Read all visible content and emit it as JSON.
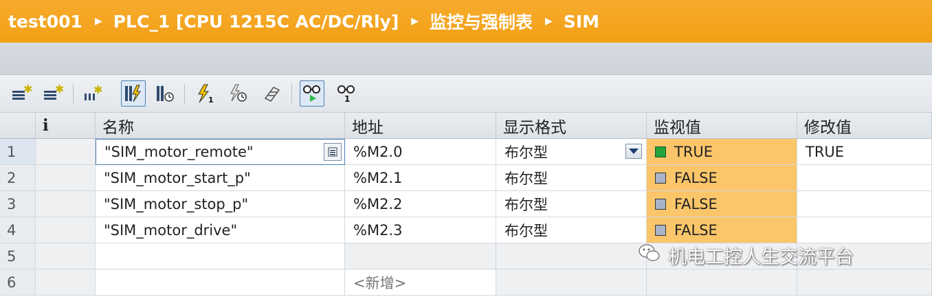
{
  "breadcrumb": {
    "items": [
      "test001",
      "PLC_1 [CPU 1215C AC/DC/Rly]",
      "监控与强制表",
      "SIM"
    ],
    "separator": "▶"
  },
  "toolbar": {
    "buttons": [
      {
        "name": "insert-row-icon",
        "glyph": "≡✱"
      },
      {
        "name": "add-row-icon",
        "glyph": "≡✱"
      },
      {
        "name": "multi-insert-icon",
        "glyph": "⁞✱"
      },
      {
        "name": "modify-now-icon",
        "glyph": "⚡"
      },
      {
        "name": "modify-trigger-icon",
        "glyph": "◷"
      },
      {
        "name": "force-icon",
        "glyph": "⚡",
        "sub": "1"
      },
      {
        "name": "force-trigger-icon",
        "glyph": "⚡"
      },
      {
        "name": "show-all-force-icon",
        "glyph": "⇆"
      },
      {
        "name": "monitor-all-icon",
        "glyph": "👓"
      },
      {
        "name": "monitor-once-icon",
        "glyph": "👓",
        "sub": "1"
      }
    ]
  },
  "table": {
    "headers": {
      "info": "i",
      "name": "名称",
      "address": "地址",
      "format": "显示格式",
      "monitor": "监视值",
      "modify": "修改值"
    },
    "rows": [
      {
        "num": "1",
        "name": "\"SIM_motor_remote\"",
        "address": "%M2.0",
        "format": "布尔型",
        "monitor": "TRUE",
        "monitor_state": "on",
        "modify": "TRUE"
      },
      {
        "num": "2",
        "name": "\"SIM_motor_start_p\"",
        "address": "%M2.1",
        "format": "布尔型",
        "monitor": "FALSE",
        "monitor_state": "off",
        "modify": ""
      },
      {
        "num": "3",
        "name": "\"SIM_motor_stop_p\"",
        "address": "%M2.2",
        "format": "布尔型",
        "monitor": "FALSE",
        "monitor_state": "off",
        "modify": ""
      },
      {
        "num": "4",
        "name": "\"SIM_motor_drive\"",
        "address": "%M2.3",
        "format": "布尔型",
        "monitor": "FALSE",
        "monitor_state": "off",
        "modify": ""
      },
      {
        "num": "5",
        "name": "",
        "address": "",
        "format": "",
        "monitor": "",
        "monitor_state": "",
        "modify": ""
      },
      {
        "num": "6",
        "name": "",
        "address": "<新增>",
        "format": "",
        "monitor": "",
        "monitor_state": "",
        "modify": ""
      }
    ]
  },
  "watermark": {
    "text": "机电工控人生交流平台"
  },
  "colors": {
    "title_bar": "#f5a623",
    "monitor_cell": "#fbc66a",
    "true_indicator": "#23a43a",
    "false_indicator": "#a8b4c8"
  }
}
